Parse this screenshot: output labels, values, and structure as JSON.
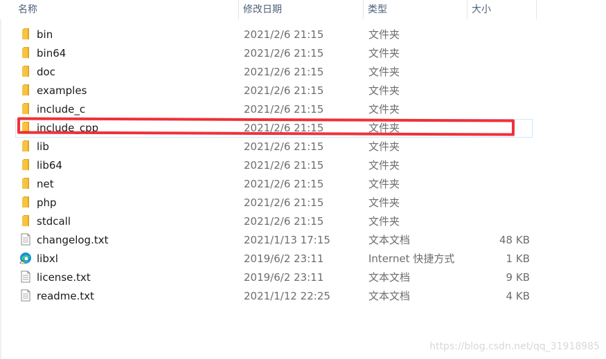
{
  "header": {
    "name": "名称",
    "date_modified": "修改日期",
    "type": "类型",
    "size": "大小"
  },
  "files": [
    {
      "name": "bin",
      "date": "2021/2/6 21:15",
      "type": "文件夹",
      "size": "",
      "icon": "folder-icon"
    },
    {
      "name": "bin64",
      "date": "2021/2/6 21:15",
      "type": "文件夹",
      "size": "",
      "icon": "folder-icon"
    },
    {
      "name": "doc",
      "date": "2021/2/6 21:15",
      "type": "文件夹",
      "size": "",
      "icon": "folder-icon"
    },
    {
      "name": "examples",
      "date": "2021/2/6 21:15",
      "type": "文件夹",
      "size": "",
      "icon": "folder-icon"
    },
    {
      "name": "include_c",
      "date": "2021/2/6 21:15",
      "type": "文件夹",
      "size": "",
      "icon": "folder-icon"
    },
    {
      "name": "include_cpp",
      "date": "2021/2/6 21:15",
      "type": "文件夹",
      "size": "",
      "icon": "folder-icon"
    },
    {
      "name": "lib",
      "date": "2021/2/6 21:15",
      "type": "文件夹",
      "size": "",
      "icon": "folder-icon"
    },
    {
      "name": "lib64",
      "date": "2021/2/6 21:15",
      "type": "文件夹",
      "size": "",
      "icon": "folder-icon"
    },
    {
      "name": "net",
      "date": "2021/2/6 21:15",
      "type": "文件夹",
      "size": "",
      "icon": "folder-icon"
    },
    {
      "name": "php",
      "date": "2021/2/6 21:15",
      "type": "文件夹",
      "size": "",
      "icon": "folder-icon"
    },
    {
      "name": "stdcall",
      "date": "2021/2/6 21:15",
      "type": "文件夹",
      "size": "",
      "icon": "folder-icon"
    },
    {
      "name": "changelog.txt",
      "date": "2021/1/13 17:15",
      "type": "文本文档",
      "size": "48 KB",
      "icon": "text-file-icon"
    },
    {
      "name": "libxl",
      "date": "2019/6/2 23:11",
      "type": "Internet 快捷方式",
      "size": "1 KB",
      "icon": "edge-shortcut-icon"
    },
    {
      "name": "license.txt",
      "date": "2019/6/2 23:11",
      "type": "文本文档",
      "size": "9 KB",
      "icon": "text-file-icon"
    },
    {
      "name": "readme.txt",
      "date": "2021/1/12 22:25",
      "type": "文本文档",
      "size": "4 KB",
      "icon": "text-file-icon"
    }
  ],
  "watermark": "https://blog.csdn.net/qq_31918985",
  "colors": {
    "folder": "#f6c443",
    "folder_dark": "#e0a526",
    "annotation": "#ee1b24",
    "header_text": "#4c607a",
    "hover_border": "#cde8ff"
  }
}
